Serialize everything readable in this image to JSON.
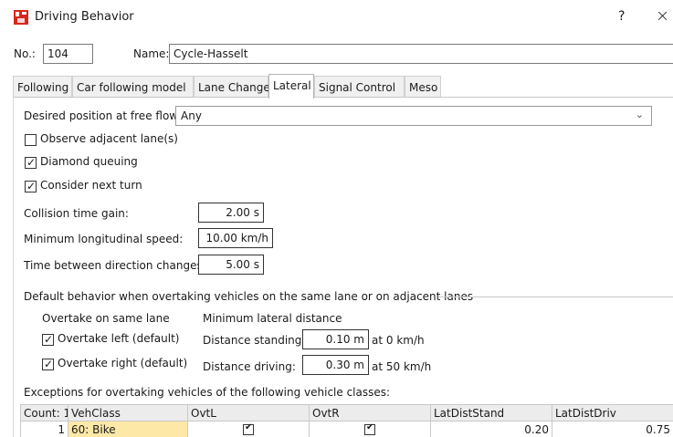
{
  "window": {
    "title": "Driving Behavior",
    "help_label": "?",
    "close_label": "×"
  },
  "header": {
    "no_label": "No.:",
    "no_value": "104",
    "name_label": "Name:",
    "name_value": "Cycle-Hasselt"
  },
  "tabs": [
    {
      "label": "Following"
    },
    {
      "label": "Car following model"
    },
    {
      "label": "Lane Change"
    },
    {
      "label": "Lateral"
    },
    {
      "label": "Signal Control"
    },
    {
      "label": "Meso"
    }
  ],
  "lateral": {
    "desired_position_label": "Desired position at free flow:",
    "desired_position_value": "Any",
    "checkboxes": [
      {
        "label": "Observe adjacent lane(s)",
        "checked": false
      },
      {
        "label": "Diamond queuing",
        "checked": true
      },
      {
        "label": "Consider next turn",
        "checked": true
      }
    ],
    "collision_time_gain_label": "Collision time gain:",
    "collision_time_gain_value": "2.00 s",
    "min_long_speed_label": "Minimum longitudinal speed:",
    "min_long_speed_value": "10.00 km/h",
    "time_between_dir_label": "Time between direction changes:",
    "time_between_dir_value": "5.00 s",
    "group_label": "Default behavior when overtaking vehicles on the same lane or on adjacent lanes",
    "overtake_same_lane_label": "Overtake on same lane",
    "min_lateral_distance_label": "Minimum lateral distance",
    "overtake_left_label": "Overtake left (default)",
    "overtake_left_checked": true,
    "overtake_right_label": "Overtake right (default)",
    "overtake_right_checked": true,
    "distance_standing_label": "Distance standing:",
    "distance_standing_value": "0.10 m",
    "distance_standing_suffix": "at 0 km/h",
    "distance_driving_label": "Distance driving:",
    "distance_driving_value": "0.30 m",
    "distance_driving_suffix": "at 50 km/h",
    "exceptions_label": "Exceptions for overtaking vehicles of the following vehicle classes:"
  },
  "grid": {
    "headers": [
      "Count: 1",
      "VehClass",
      "OvtL",
      "OvtR",
      "LatDistStand",
      "LatDistDriv"
    ],
    "rows": [
      {
        "index": "1",
        "vehclass": "60: Bike",
        "ovtl": true,
        "ovtr": true,
        "latdiststand": "0.20",
        "latdistdriv": "0.75"
      }
    ]
  },
  "colors": {
    "accent_red": "#d9261c",
    "vehclass_highlight": "#fde8a8"
  },
  "icons": {
    "app": "driving-behavior-icon",
    "checkmark": "check-icon",
    "dropdown": "chevron-down-icon"
  }
}
